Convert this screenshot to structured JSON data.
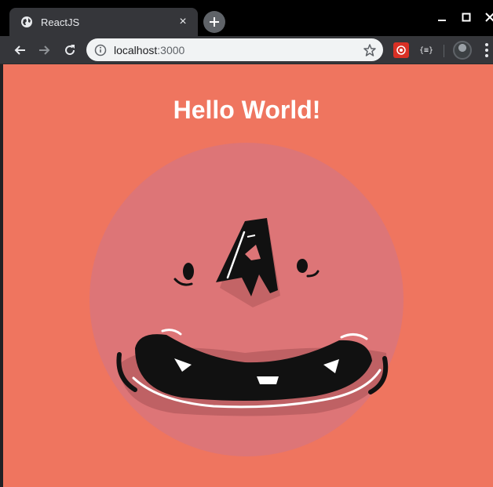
{
  "tab": {
    "title": "ReactJS",
    "close": "×"
  },
  "address_bar": {
    "host": "localhost",
    "port": ":3000"
  },
  "extensions": {
    "ext2_label": "{≡}"
  },
  "page": {
    "heading": "Hello World!"
  },
  "colors": {
    "page_background": "#ef755f",
    "circle": "#dd7577",
    "tab_bg": "#35363a"
  },
  "icons": [
    "globe-icon",
    "close-icon",
    "plus-icon",
    "minimize-icon",
    "maximize-icon",
    "back-icon",
    "forward-icon",
    "reload-icon",
    "info-icon",
    "star-icon",
    "extension-icon",
    "profile-avatar",
    "kebab-menu-icon"
  ]
}
